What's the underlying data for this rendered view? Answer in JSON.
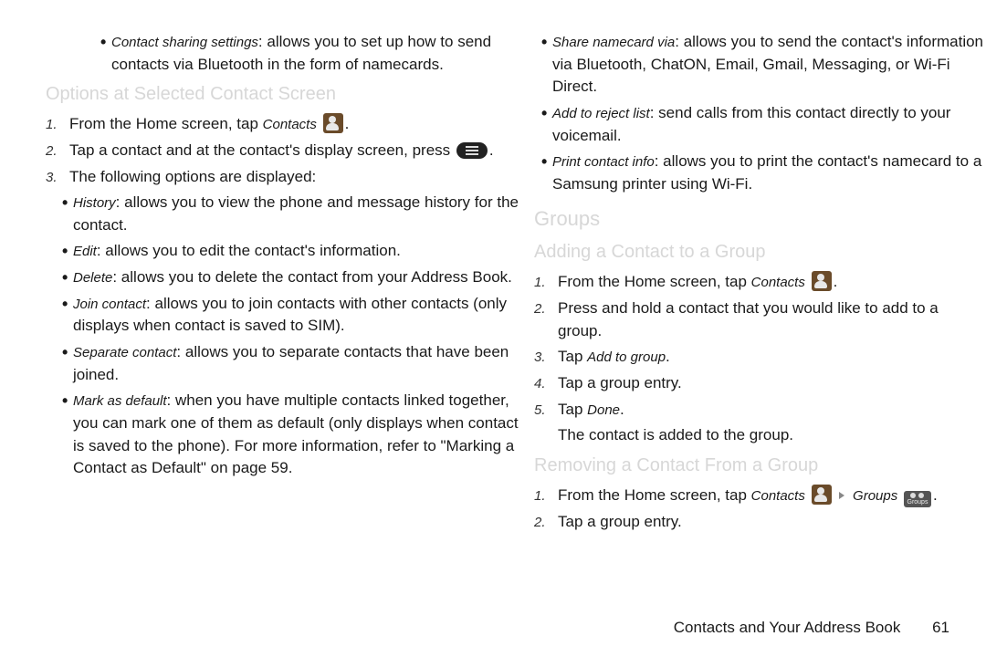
{
  "left": {
    "intro_bullet_term": "Contact sharing settings",
    "intro_bullet_text": ": allows you to set up how to send contacts via Bluetooth in the form of namecards.",
    "heading": "Options at Selected Contact Screen",
    "step1_a": "From the Home screen, tap ",
    "step1_contacts": "Contacts",
    "step1_b": ".",
    "step2": "Tap a contact and at the contact's display screen, press ",
    "step2_b": ".",
    "step3": "The following options are displayed:",
    "opts": [
      {
        "term": "History",
        "text": ": allows you to view the phone and message history for the contact."
      },
      {
        "term": "Edit",
        "text": ": allows you to edit the contact's information."
      },
      {
        "term": "Delete",
        "text": ": allows you to delete the contact from your Address Book."
      },
      {
        "term": "Join contact",
        "text": ": allows you to join contacts with other contacts (only displays when contact is saved to SIM)."
      },
      {
        "term": "Separate contact",
        "text": ": allows you to separate contacts that have been joined."
      },
      {
        "term": "Mark as default",
        "text": ": when you have multiple contacts linked together, you can mark one of them as default (only displays when contact is saved to the phone). For more information, refer to \"Marking a Contact as Default\" on page 59."
      }
    ]
  },
  "right": {
    "top_opts": [
      {
        "term": "Share namecard via",
        "text": ": allows you to send the contact's information via Bluetooth, ChatON, Email, Gmail, Messaging, or Wi-Fi Direct."
      },
      {
        "term": "Add to reject list",
        "text": ": send calls from this contact directly to your voicemail."
      },
      {
        "term": "Print contact info",
        "text": ": allows you to print the contact's namecard to a Samsung printer using Wi-Fi."
      }
    ],
    "groups_heading": "Groups",
    "adding_heading": "Adding a Contact to a Group",
    "add_step1_a": "From the Home screen, tap ",
    "add_step1_contacts": "Contacts",
    "add_step1_b": ".",
    "add_step2": "Press and hold a contact that you would like to add to a group.",
    "add_step3_a": "Tap ",
    "add_step3_term": "Add to group",
    "add_step3_b": ".",
    "add_step4": "Tap a group entry.",
    "add_step5_a": "Tap ",
    "add_step5_term": "Done",
    "add_step5_b": ".",
    "add_result": "The contact is added to the group.",
    "removing_heading": "Removing a Contact From a Group",
    "rem_step1_a": "From the Home screen, tap ",
    "rem_step1_contacts": "Contacts",
    "rem_step1_sep": " ",
    "rem_step1_groups": "Groups",
    "rem_step1_b": ".",
    "rem_step2": "Tap a group entry."
  },
  "footer": {
    "title": "Contacts and Your Address Book",
    "page": "61"
  },
  "icons": {
    "groups_label": "Groups"
  }
}
